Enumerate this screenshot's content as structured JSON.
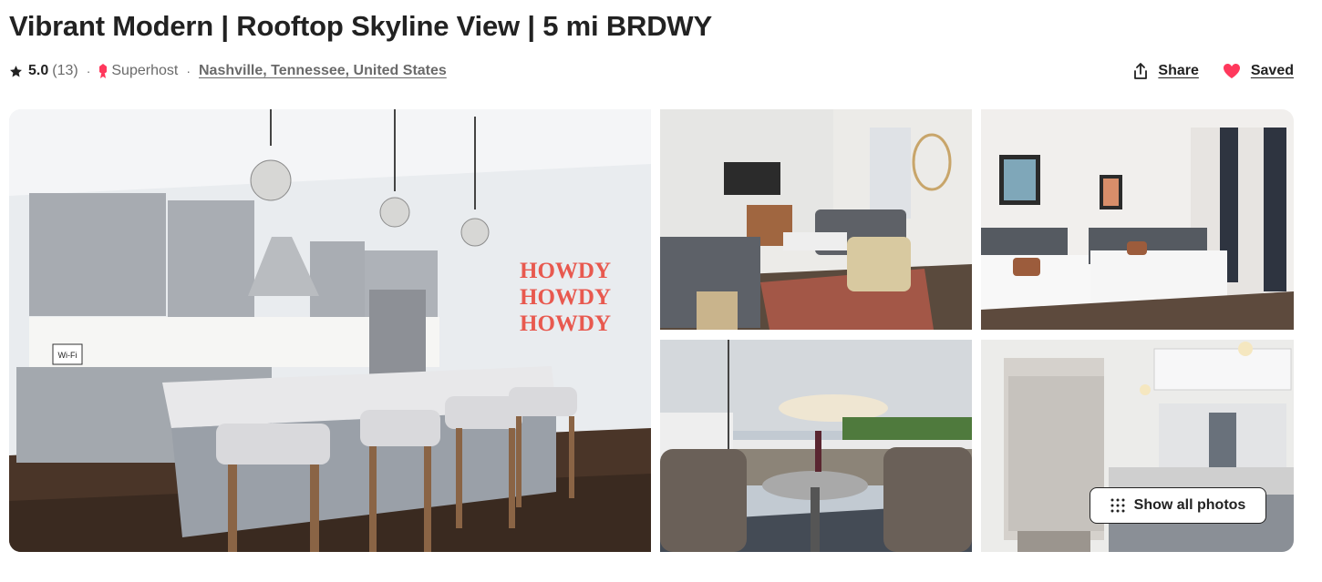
{
  "listing": {
    "title": "Vibrant Modern | Rooftop Skyline View | 5 mi BRDWY",
    "rating": "5.0",
    "reviews": "(13)",
    "separator": "·",
    "superhost_label": "Superhost",
    "location": "Nashville, Tennessee, United States"
  },
  "actions": {
    "share_label": "Share",
    "saved_label": "Saved"
  },
  "gallery": {
    "show_all_label": "Show all photos",
    "wall_text": [
      "HOWDY",
      "HOWDY",
      "HOWDY"
    ],
    "wifi_sign": "Wi-Fi"
  },
  "colors": {
    "accent": "#ff385c",
    "text": "#222222",
    "muted": "#6a6a6a"
  },
  "icons": {
    "rating": "star-icon",
    "superhost": "superhost-badge-icon",
    "share": "share-icon",
    "saved": "heart-filled-icon",
    "show_all": "grid-dots-icon"
  }
}
